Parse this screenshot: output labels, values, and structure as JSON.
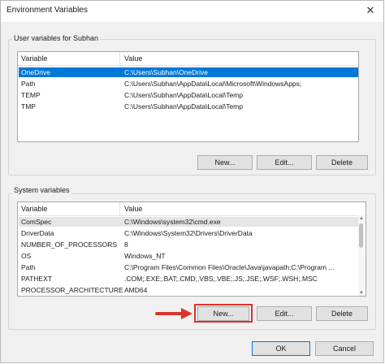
{
  "window": {
    "title": "Environment Variables",
    "close_glyph": "✕"
  },
  "user_vars": {
    "group_label": "User variables for Subhan",
    "headers": {
      "variable": "Variable",
      "value": "Value"
    },
    "rows": [
      {
        "variable": "OneDrive",
        "value": "C:\\Users\\Subhan\\OneDrive"
      },
      {
        "variable": "Path",
        "value": "C:\\Users\\Subhan\\AppData\\Local\\Microsoft\\WindowsApps;"
      },
      {
        "variable": "TEMP",
        "value": "C:\\Users\\Subhan\\AppData\\Local\\Temp"
      },
      {
        "variable": "TMP",
        "value": "C:\\Users\\Subhan\\AppData\\Local\\Temp"
      }
    ],
    "buttons": {
      "new": "New...",
      "edit": "Edit...",
      "delete": "Delete"
    }
  },
  "system_vars": {
    "group_label": "System variables",
    "headers": {
      "variable": "Variable",
      "value": "Value"
    },
    "rows": [
      {
        "variable": "ComSpec",
        "value": "C:\\Windows\\system32\\cmd.exe"
      },
      {
        "variable": "DriverData",
        "value": "C:\\Windows\\System32\\Drivers\\DriverData"
      },
      {
        "variable": "NUMBER_OF_PROCESSORS",
        "value": "8"
      },
      {
        "variable": "OS",
        "value": "Windows_NT"
      },
      {
        "variable": "Path",
        "value": "C:\\Program Files\\Common Files\\Oracle\\Java\\javapath;C:\\Program ..."
      },
      {
        "variable": "PATHEXT",
        "value": ".COM;.EXE;.BAT;.CMD;.VBS;.VBE;.JS;.JSE;.WSF;.WSH;.MSC"
      },
      {
        "variable": "PROCESSOR_ARCHITECTURE",
        "value": "AMD64"
      }
    ],
    "buttons": {
      "new": "New...",
      "edit": "Edit...",
      "delete": "Delete"
    }
  },
  "footer": {
    "ok": "OK",
    "cancel": "Cancel"
  },
  "colors": {
    "selection": "#0078d7",
    "annotation": "#d9342b"
  }
}
